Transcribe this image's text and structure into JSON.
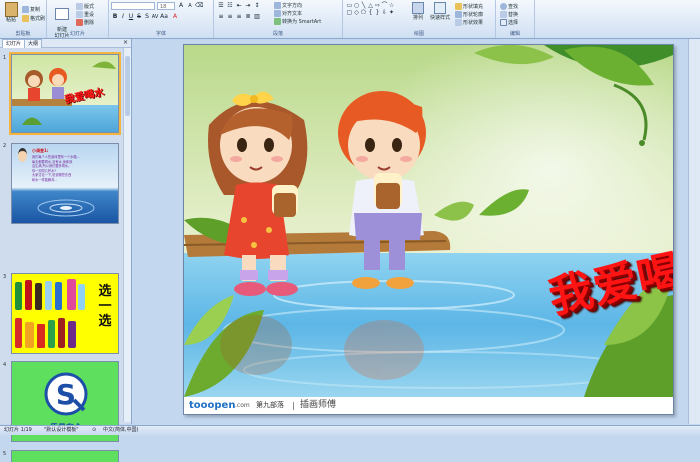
{
  "ribbon": {
    "clipboard": {
      "paste": "粘贴",
      "copy": "复制",
      "format": "格式刷",
      "group": "剪贴板"
    },
    "slides": {
      "new_slide": "新建\n幻灯片",
      "layout": "版式",
      "reset": "重设",
      "delete": "删除",
      "group": "幻灯片"
    },
    "font": {
      "font_name": "",
      "font_size": "18",
      "group": "字体"
    },
    "paragraph": {
      "text_direction": "文字方向",
      "align_text": "对齐文本",
      "smartart": "转换为 SmartArt",
      "group": "段落"
    },
    "drawing": {
      "arrange": "排列",
      "quick_styles": "快速样式",
      "fill": "形状填充",
      "outline": "形状轮廓",
      "effects": "形状效果",
      "group": "绘图"
    },
    "editing": {
      "find": "查找",
      "replace": "替换",
      "select": "选择",
      "group": "编辑"
    }
  },
  "left_pane": {
    "tabs": [
      "幻灯片",
      "大纲"
    ],
    "close": "×",
    "slide_numbers": [
      "1",
      "2",
      "3",
      "4",
      "5"
    ],
    "thumb1_title": "我爱喝水",
    "thumb2": {
      "heading": "小调查1:",
      "body_lines": [
        "我们每个人的身体里有一个水箱...",
        "每天都要喝水,没有水,身体就",
        "会生病,所以我们要多喝水。",
        "你一天喝几杯水?",
        "大家讨论一下,说说哪些东西",
        "和水一样能解渴..."
      ]
    },
    "thumb3_text": [
      "选",
      "一",
      "选"
    ],
    "thumb4_text": "质量安全"
  },
  "slide": {
    "title": "我爱喝水",
    "credit_brand": "tooopen",
    "credit_domain": ".com",
    "credit_cn": "第九部落",
    "credit_author": "插画师傅"
  },
  "status_bar": {
    "slide_pos": "幻灯片 1/19",
    "theme": "\"默认设计模板\"",
    "lang": "中文(简体,中国)"
  },
  "colors": {
    "title_red": "#ff1414",
    "thumb_green": "#5ee05e",
    "thumb_yellow": "#ffff00",
    "thumb_blue": "#1d4fa8"
  }
}
